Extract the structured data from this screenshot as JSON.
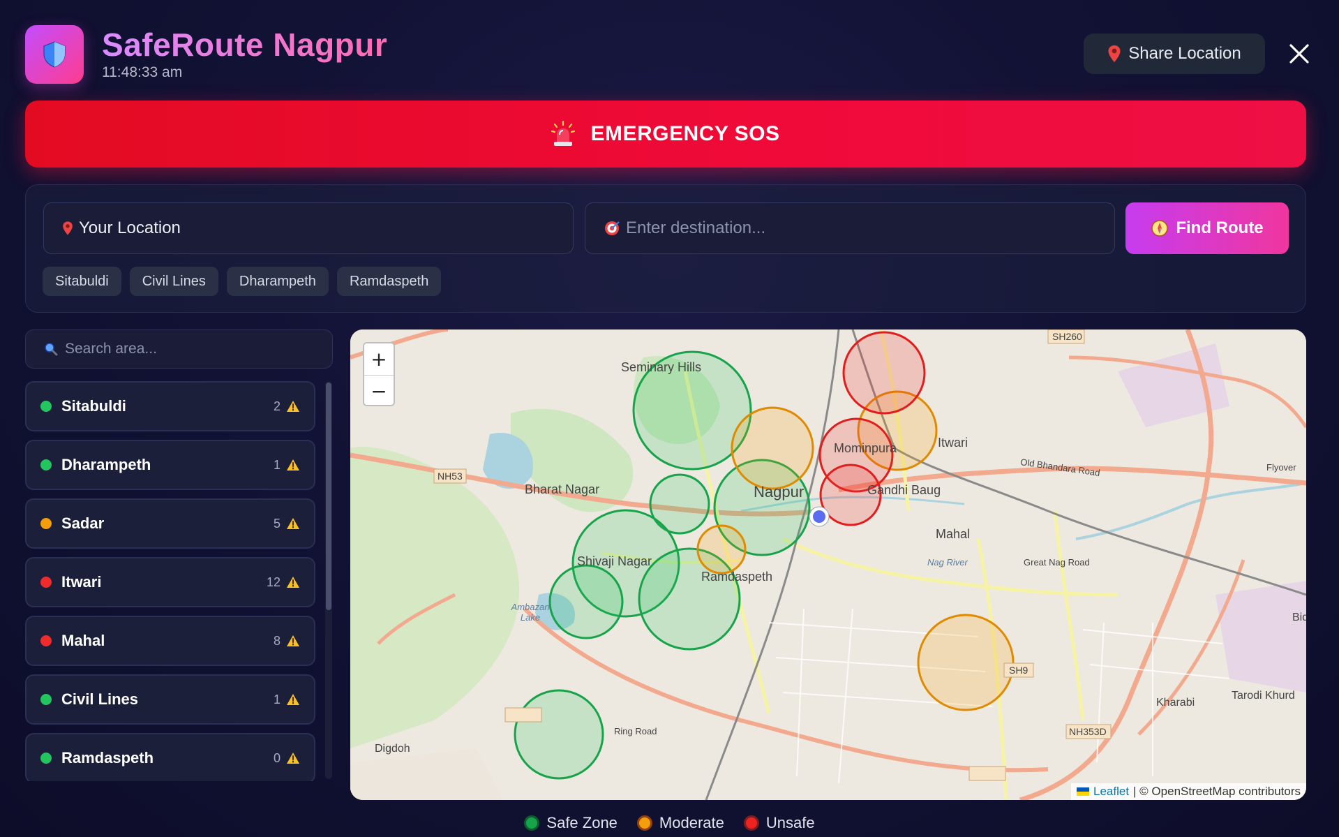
{
  "header": {
    "title": "SafeRoute Nagpur",
    "time": "11:48:33 am",
    "share_label": "Share Location",
    "logo_icon": "shield-icon",
    "share_icon": "pin-icon",
    "close_icon": "close-icon"
  },
  "sos": {
    "label": "EMERGENCY SOS",
    "icon": "siren-icon"
  },
  "route": {
    "origin_value": "Your Location",
    "destination_placeholder": "Enter destination...",
    "find_label": "Find Route",
    "chips": [
      "Sitabuldi",
      "Civil Lines",
      "Dharampeth",
      "Ramdaspeth"
    ]
  },
  "sidebar": {
    "search_placeholder": "Search area...",
    "areas": [
      {
        "name": "Sitabuldi",
        "count": "2",
        "status": "safe"
      },
      {
        "name": "Dharampeth",
        "count": "1",
        "status": "safe"
      },
      {
        "name": "Sadar",
        "count": "5",
        "status": "moderate"
      },
      {
        "name": "Itwari",
        "count": "12",
        "status": "unsafe"
      },
      {
        "name": "Mahal",
        "count": "8",
        "status": "unsafe"
      },
      {
        "name": "Civil Lines",
        "count": "1",
        "status": "safe"
      },
      {
        "name": "Ramdaspeth",
        "count": "0",
        "status": "safe"
      }
    ]
  },
  "map": {
    "zoom_in": "+",
    "zoom_out": "−",
    "attribution_link": "Leaflet",
    "attribution_text": "| © OpenStreetMap contributors",
    "labels": [
      "Seminary Hills",
      "Bharat Nagar",
      "Nagpur",
      "Mominpura",
      "Itwari",
      "Gandhi Baug",
      "Mahal",
      "Shivaji Nagar",
      "Ramdaspeth",
      "Ambazari Lake",
      "Digdoh",
      "Kharabi",
      "Tarodi Khurd",
      "NH53",
      "SH260",
      "SH9",
      "NH353D",
      "Ring Road",
      "Great Nag Road",
      "Old Bhandara Road",
      "Flyover",
      "Nag River",
      "Bid"
    ]
  },
  "legend": [
    {
      "label": "Safe Zone",
      "color": "#16a34a"
    },
    {
      "label": "Moderate",
      "color": "#f59e0b"
    },
    {
      "label": "Unsafe",
      "color": "#ef2222"
    }
  ],
  "colors": {
    "safe": "#22c55e",
    "moderate": "#f59e0b",
    "unsafe": "#ef2b2b"
  }
}
